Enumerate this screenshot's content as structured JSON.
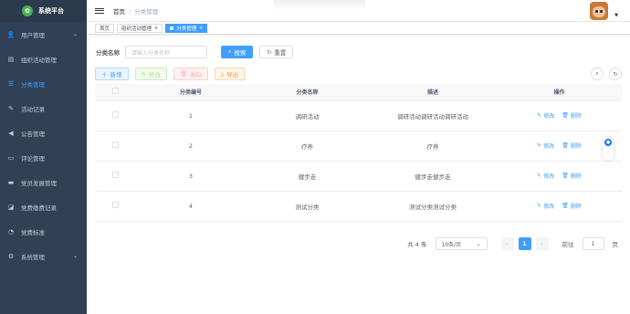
{
  "app": {
    "title": "系统平台"
  },
  "sidebar": {
    "items": [
      {
        "label": "用户管理",
        "icon": "user-icon",
        "expandable": true
      },
      {
        "label": "组织活动管理",
        "icon": "document-icon",
        "expandable": false
      },
      {
        "label": "分类管理",
        "icon": "list-icon",
        "expandable": false,
        "active": true
      },
      {
        "label": "活动记录",
        "icon": "edit-icon",
        "expandable": false
      },
      {
        "label": "公告管理",
        "icon": "megaphone-icon",
        "expandable": false
      },
      {
        "label": "评论管理",
        "icon": "comment-icon",
        "expandable": false
      },
      {
        "label": "党员发展管理",
        "icon": "folder-icon",
        "expandable": false
      },
      {
        "label": "党费缴费记录",
        "icon": "wallet-icon",
        "expandable": false
      },
      {
        "label": "党费标准",
        "icon": "standard-icon",
        "expandable": false
      },
      {
        "label": "系统管理",
        "icon": "gear-icon",
        "expandable": true
      }
    ]
  },
  "header": {
    "breadcrumb": [
      "首页",
      "分类管理"
    ]
  },
  "tags": [
    {
      "label": "首页",
      "active": false,
      "closable": false
    },
    {
      "label": "组织活动管理",
      "active": false,
      "closable": true
    },
    {
      "label": "分类管理",
      "active": true,
      "closable": true
    }
  ],
  "search": {
    "label": "分类名称",
    "placeholder": "请输入分类名称",
    "search_button": "搜索",
    "reset_button": "重置"
  },
  "toolbar": {
    "add": "新增",
    "edit": "修改",
    "delete": "删除",
    "export": "导出"
  },
  "table": {
    "columns": [
      "分类编号",
      "分类名称",
      "描述",
      "操作"
    ],
    "rows": [
      {
        "id": "1",
        "name": "调研活动",
        "desc": "调研活动调研活动调研活动"
      },
      {
        "id": "2",
        "name": "疗养",
        "desc": "疗养"
      },
      {
        "id": "3",
        "name": "健步走",
        "desc": "健步走健步走"
      },
      {
        "id": "4",
        "name": "测试分类",
        "desc": "测试分类测试分类"
      }
    ],
    "edit_label": "修改",
    "delete_label": "删除"
  },
  "pagination": {
    "total_text": "共 4 条",
    "page_size": "10条/页",
    "current_page": "1",
    "goto_label": "前往",
    "goto_value": "1",
    "page_suffix": "页"
  },
  "colors": {
    "sidebar_bg": "#304156",
    "primary": "#409eff",
    "active_menu": "#409eff"
  }
}
